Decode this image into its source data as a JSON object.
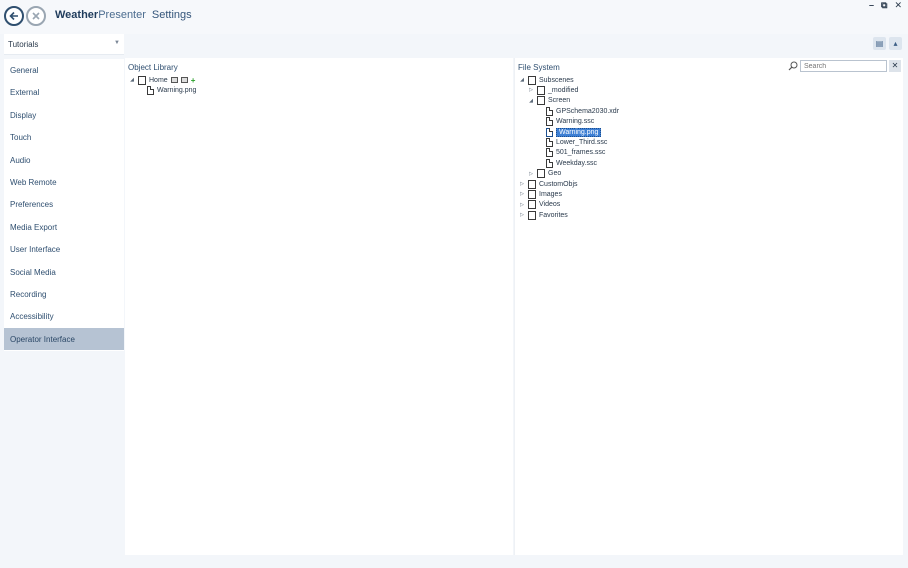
{
  "titlebar": {
    "app_name_bold": "Weather",
    "app_name_light": "Presenter",
    "page_title": "Settings",
    "window_controls": [
      "–",
      "⧉",
      "✕"
    ]
  },
  "sidebar": {
    "dropdown_value": "Tutorials",
    "items": [
      {
        "label": "General"
      },
      {
        "label": "External"
      },
      {
        "label": "Display"
      },
      {
        "label": "Touch"
      },
      {
        "label": "Audio"
      },
      {
        "label": "Web Remote"
      },
      {
        "label": "Preferences"
      },
      {
        "label": "Media Export"
      },
      {
        "label": "User Interface"
      },
      {
        "label": "Social Media"
      },
      {
        "label": "Recording"
      },
      {
        "label": "Accessibility"
      },
      {
        "label": "Operator Interface"
      }
    ],
    "selected": "Operator Interface"
  },
  "object_library": {
    "title": "Object Library",
    "home": "Home",
    "child": "Warning.png"
  },
  "file_system": {
    "title": "File System",
    "search_placeholder": "Search",
    "nodes": {
      "subscenes": "Subscenes",
      "modified": "_modified",
      "screen": "Screen",
      "gpschema": "GPSchema2030.xdr",
      "warning_ssc": "Warning.ssc",
      "warning_png": "Warning.png",
      "lower_third": "Lower_Third.ssc",
      "frames": "501_frames.ssc",
      "weekday": "Weekday.ssc",
      "geo": "Geo",
      "customobjs": "CustomObjs",
      "images": "Images",
      "videos": "Videos",
      "favorites": "Favorites"
    }
  },
  "colors": {
    "accent": "#3d7fd4",
    "sidebar_selected": "#b6c3d3",
    "add_green": "#2aa02a"
  }
}
